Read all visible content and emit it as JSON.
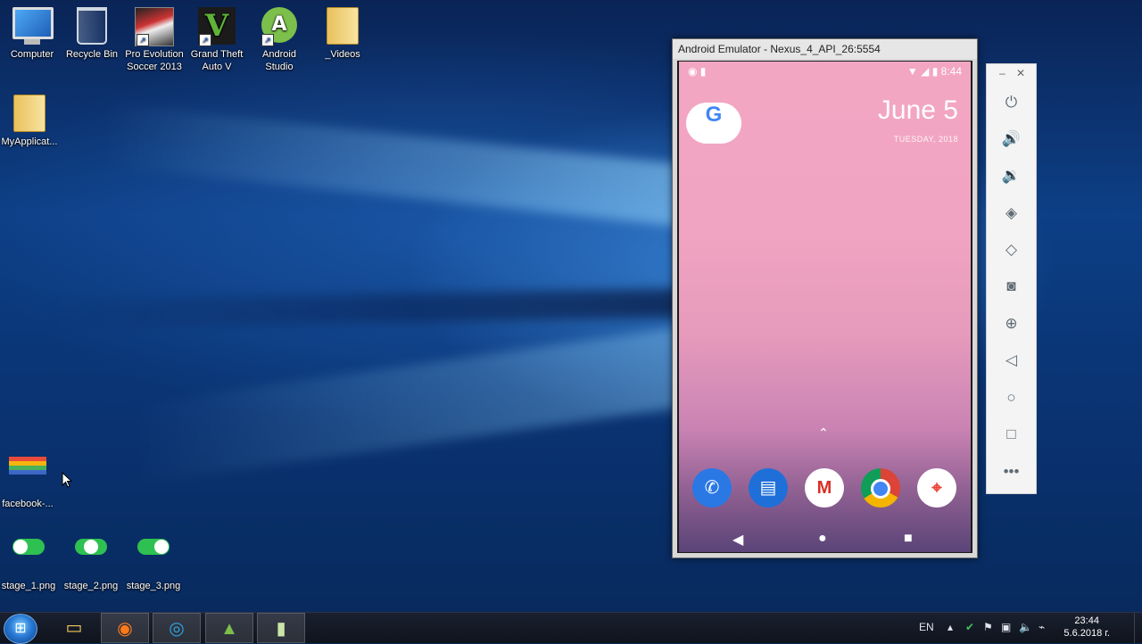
{
  "desktop": {
    "icons": [
      {
        "label": "Computer",
        "icon": "computer-icon"
      },
      {
        "label": "Recycle Bin",
        "icon": "recycle-bin-icon"
      },
      {
        "label": "Pro Evolution Soccer 2013",
        "icon": "pes-2013-icon"
      },
      {
        "label": "Grand Theft Auto V",
        "icon": "gta-v-icon"
      },
      {
        "label": "Android Studio",
        "icon": "android-studio-icon"
      },
      {
        "label": "_Videos",
        "icon": "folder-icon"
      },
      {
        "label": "MyApplicat...",
        "icon": "folder-icon"
      },
      {
        "label": "facebook-...",
        "icon": "image-file-icon"
      },
      {
        "label": "stage_1.png",
        "icon": "toggle-image-icon"
      },
      {
        "label": "stage_2.png",
        "icon": "toggle-image-icon"
      },
      {
        "label": "stage_3.png",
        "icon": "toggle-image-icon"
      }
    ]
  },
  "emulator": {
    "title": "Android Emulator - Nexus_4_API_26:5554",
    "status_time": "8:44",
    "date": "June 5",
    "day": "TUESDAY, 2018",
    "google_letter": "G",
    "dock_apps": [
      "phone-app-icon",
      "messages-app-icon",
      "gmail-app-icon",
      "chrome-app-icon",
      "maps-app-icon"
    ],
    "nav": [
      "back-icon",
      "home-icon",
      "recents-icon"
    ]
  },
  "toolbar": {
    "buttons": [
      "power-icon",
      "volume-up-icon",
      "volume-down-icon",
      "rotate-left-icon",
      "rotate-right-icon",
      "camera-icon",
      "zoom-icon",
      "back-icon",
      "home-icon",
      "overview-icon",
      "more-icon"
    ]
  },
  "taskbar": {
    "apps": [
      "file-explorer-icon",
      "firefox-icon",
      "edge-icon",
      "android-studio-icon",
      "emulator-icon"
    ],
    "language": "EN",
    "time": "23:44",
    "date": "5.6.2018 г."
  },
  "colors": {
    "toggle_green": "#2fc052",
    "android_green": "#7cbf4b",
    "google_blue": "#4285f4"
  }
}
